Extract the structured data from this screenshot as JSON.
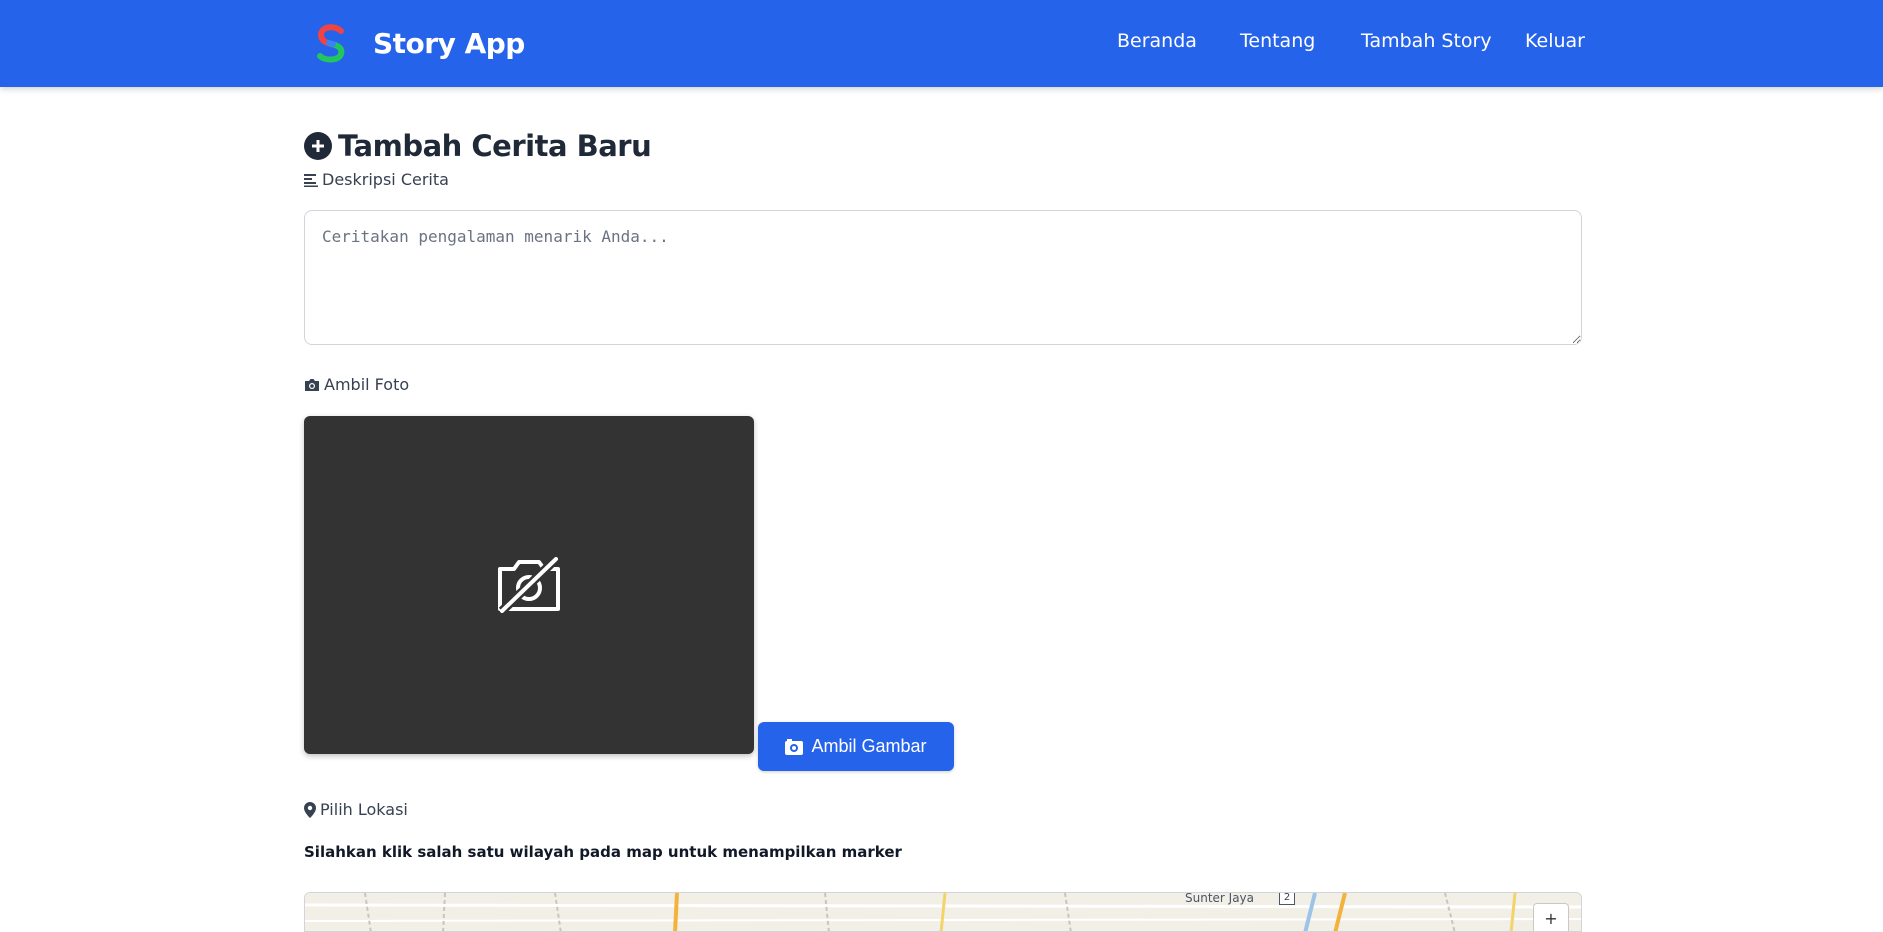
{
  "app": {
    "name": "Story App",
    "brand_colors": {
      "primary": "#2563eb",
      "logo_top": "#ef4444",
      "logo_bottom": "#22c55e"
    }
  },
  "nav": {
    "items": [
      {
        "label": "Beranda"
      },
      {
        "label": "Tentang"
      },
      {
        "label": "Tambah Story"
      },
      {
        "label": "Keluar"
      }
    ]
  },
  "page": {
    "title": "Tambah Cerita Baru",
    "title_icon": "plus-circle-icon"
  },
  "form": {
    "description": {
      "label": "Deskripsi Cerita",
      "icon": "align-left-icon",
      "placeholder": "Ceritakan pengalaman menarik Anda...",
      "value": ""
    },
    "photo": {
      "label": "Ambil Foto",
      "icon": "camera-icon",
      "preview_icon": "camera-off-icon",
      "capture_button": "Ambil Gambar"
    },
    "location": {
      "label": "Pilih Lokasi",
      "icon": "map-pin-icon",
      "hint": "Silahkan klik salah satu wilayah pada map untuk menampilkan marker",
      "map_place_label": "Sunter Jaya",
      "map_route_badge": "2",
      "zoom_in_label": "+"
    }
  }
}
